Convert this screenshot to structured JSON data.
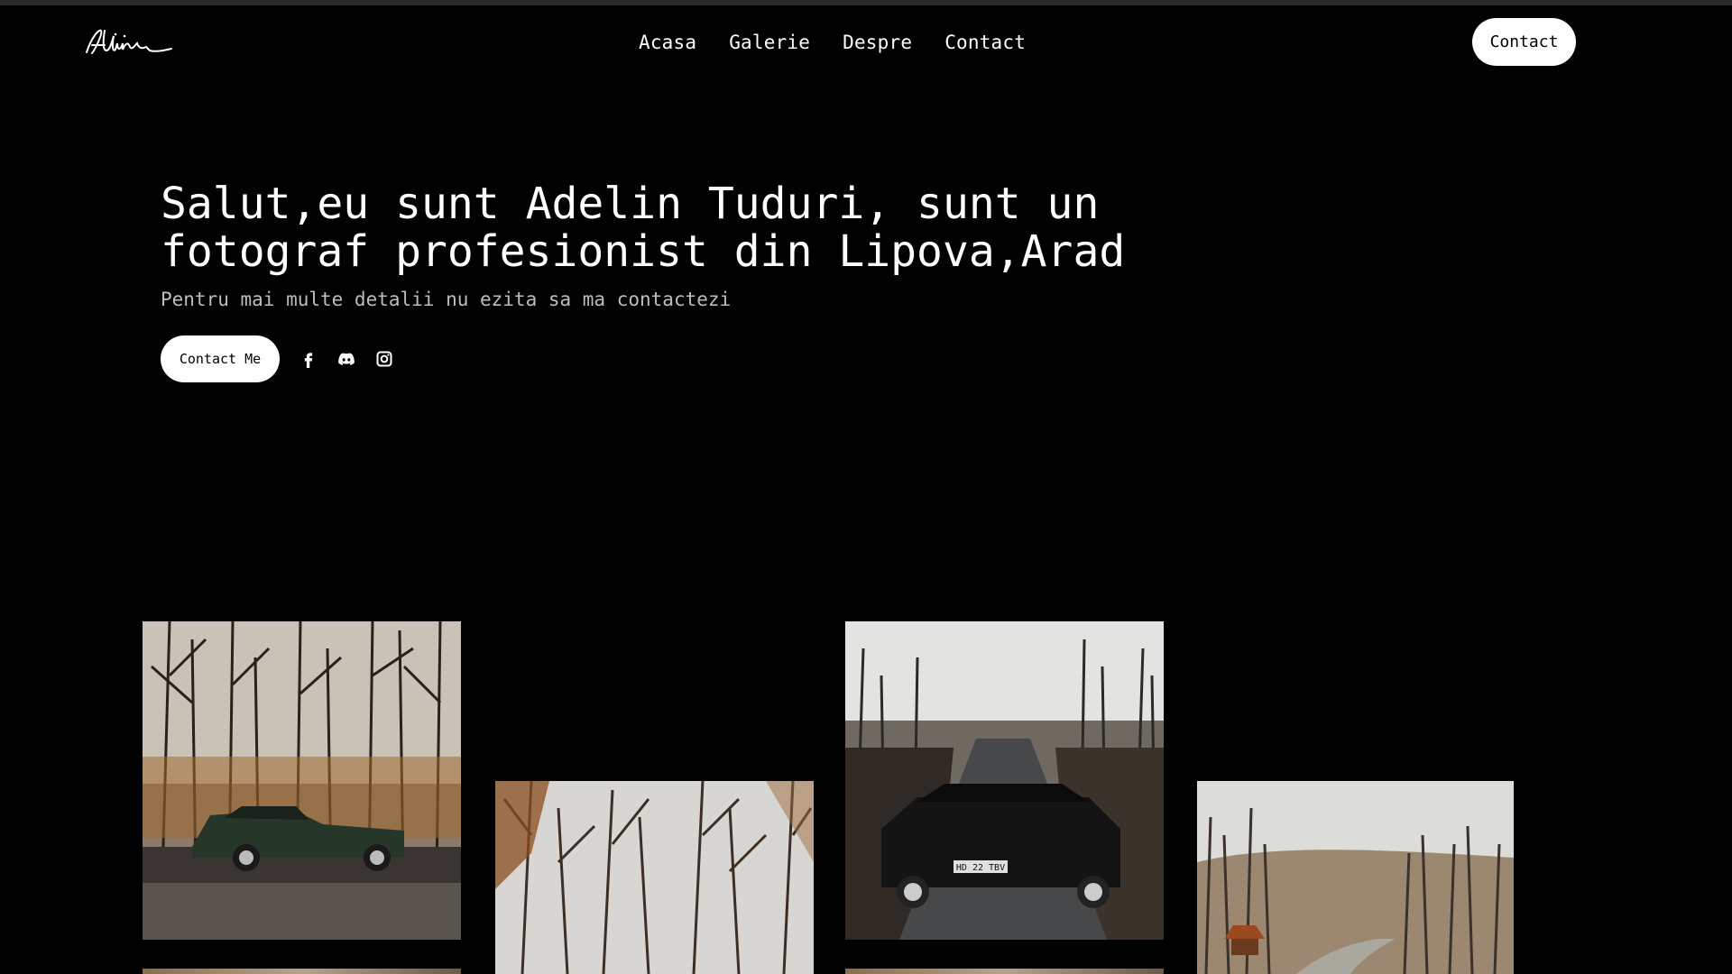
{
  "brand": {
    "logo_text": "Adelin",
    "logo_icon": "signature-logo"
  },
  "nav": {
    "items": [
      {
        "label": "Acasa"
      },
      {
        "label": "Galerie"
      },
      {
        "label": "Despre"
      },
      {
        "label": "Contact"
      }
    ],
    "cta_label": "Contact"
  },
  "hero": {
    "title": "Salut,eu sunt Adelin Tuduri, sunt un fotograf profesionist din Lipova,Arad",
    "subtitle": "Pentru mai multe detalii nu ezita sa ma contactezi",
    "cta_label": "Contact Me",
    "social": [
      {
        "icon": "facebook-icon"
      },
      {
        "icon": "discord-icon"
      },
      {
        "icon": "instagram-icon"
      }
    ]
  },
  "gallery": {
    "photos": [
      {
        "subject": "green station wagon in autumn forest"
      },
      {
        "subject": "bare autumn trees"
      },
      {
        "subject": "black BMW wagon on forest road"
      },
      {
        "subject": "hillside road with wooden shelter"
      }
    ],
    "plate_text": "HD 22 TBV"
  },
  "colors": {
    "background": "#000000",
    "text": "#ffffff",
    "button_bg": "#ffffff",
    "button_text": "#000000",
    "subtitle": "#bdbdbd"
  }
}
